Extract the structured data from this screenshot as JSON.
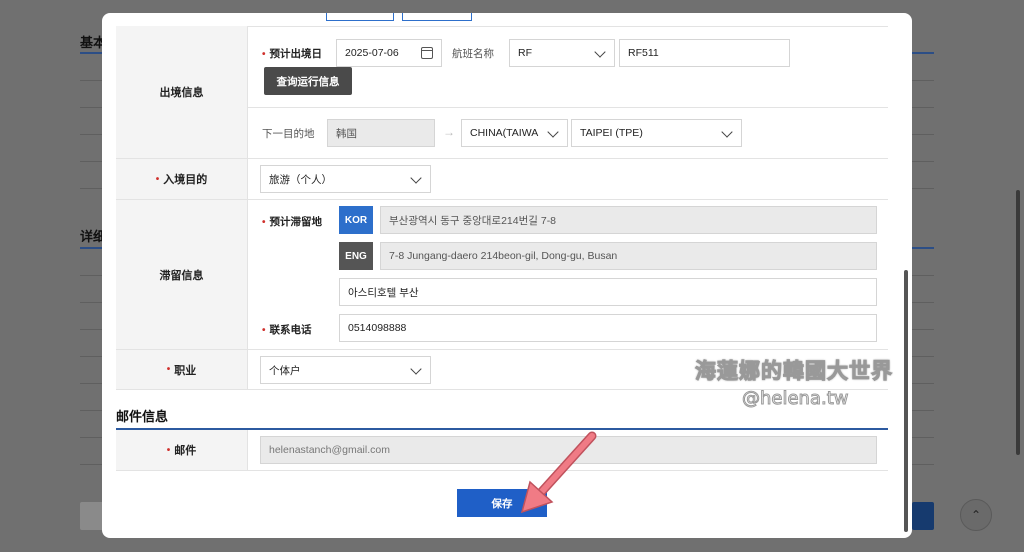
{
  "background": {
    "heading_basic": "基本",
    "heading_detail": "详细"
  },
  "departure": {
    "label": "出境信息",
    "expected_date_label": "预计出境日",
    "expected_date_value": "2025-07-06",
    "flight_label": "航班名称",
    "airline_value": "RF",
    "flight_no_value": "RF511",
    "query_button": "查询运行信息",
    "next_dest_label": "下一目的地",
    "next_dest_value": "韩国",
    "next_country_value": "CHINA(TAIWA",
    "next_airport_value": "TAIPEI (TPE)"
  },
  "purpose": {
    "label": "入境目的",
    "value": "旅游（个人）"
  },
  "stay": {
    "label": "滞留信息",
    "address_label": "预计滞留地",
    "kor_tag": "KOR",
    "kor_address": "부산광역시 동구 중앙대로214번길 7-8",
    "eng_tag": "ENG",
    "eng_address": "7-8 Jungang-daero 214beon-gil, Dong-gu, Busan",
    "hotel": "아스티호텔 부산",
    "phone_label": "联系电话",
    "phone_value": "0514098888"
  },
  "occupation": {
    "label": "职业",
    "value": "个体户"
  },
  "mail_section": {
    "title": "邮件信息",
    "label": "邮件",
    "value": "helenastanch@gmail.com"
  },
  "save_button": "保存",
  "watermark": {
    "line1": "海蓮娜的韓國大世界",
    "line2": "@helena.tw"
  },
  "colors": {
    "accent": "#1f5fc7",
    "required": "#d0312d",
    "annotation_arrow": "#f07b85"
  }
}
